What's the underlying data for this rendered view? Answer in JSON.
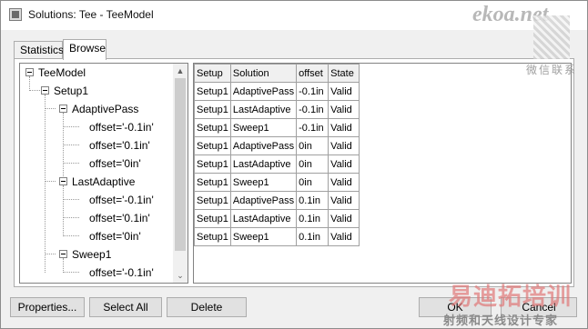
{
  "window": {
    "title": "Solutions: Tee - TeeModel"
  },
  "tabs": [
    {
      "label": "Statistics",
      "active": false
    },
    {
      "label": "Browse",
      "active": true
    }
  ],
  "tree": {
    "root": "TeeModel",
    "setup": "Setup1",
    "groups": [
      {
        "label": "AdaptivePass",
        "items": [
          "offset='-0.1in'",
          "offset='0.1in'",
          "offset='0in'"
        ]
      },
      {
        "label": "LastAdaptive",
        "items": [
          "offset='-0.1in'",
          "offset='0.1in'",
          "offset='0in'"
        ]
      },
      {
        "label": "Sweep1",
        "items": [
          "offset='-0.1in'"
        ]
      }
    ]
  },
  "grid": {
    "columns": [
      "Setup",
      "Solution",
      "offset",
      "State"
    ],
    "rows": [
      [
        "Setup1",
        "AdaptivePass",
        "-0.1in",
        "Valid"
      ],
      [
        "Setup1",
        "LastAdaptive",
        "-0.1in",
        "Valid"
      ],
      [
        "Setup1",
        "Sweep1",
        "-0.1in",
        "Valid"
      ],
      [
        "Setup1",
        "AdaptivePass",
        "0in",
        "Valid"
      ],
      [
        "Setup1",
        "LastAdaptive",
        "0in",
        "Valid"
      ],
      [
        "Setup1",
        "Sweep1",
        "0in",
        "Valid"
      ],
      [
        "Setup1",
        "AdaptivePass",
        "0.1in",
        "Valid"
      ],
      [
        "Setup1",
        "LastAdaptive",
        "0.1in",
        "Valid"
      ],
      [
        "Setup1",
        "Sweep1",
        "0.1in",
        "Valid"
      ]
    ]
  },
  "buttons": {
    "properties": "Properties...",
    "select_all": "Select All",
    "delete": "Delete",
    "ok": "OK",
    "cancel": "Cancel"
  },
  "watermarks": {
    "site": "ekoa.net",
    "wechat": "微信联系",
    "brand": "易迪拓培训",
    "tagline": "射频和天线设计专家"
  }
}
